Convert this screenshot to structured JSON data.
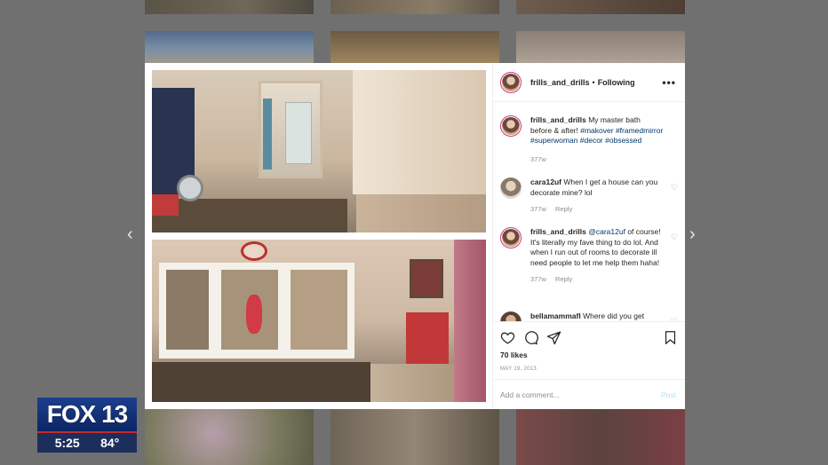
{
  "navigation": {
    "prev_icon": "chevron-left-icon",
    "next_icon": "chevron-right-icon",
    "prev_label": "‹",
    "next_label": "›"
  },
  "post": {
    "username": "frills_and_drills",
    "separator": "•",
    "follow_status": "Following",
    "more_label": "•••",
    "caption": {
      "username": "frills_and_drills",
      "text": "My master bath before & after!",
      "hashtags": [
        "#makover",
        "#framedmirror",
        "#superwoman",
        "#decor",
        "#obsessed"
      ],
      "time": "377w"
    },
    "comments": [
      {
        "username": "cara12uf",
        "text": "When I get a house can you decorate mine? lol",
        "time": "377w",
        "reply_label": "Reply"
      },
      {
        "username": "frills_and_drills",
        "mention": "@cara12uf",
        "text": "of course! It's literally my fave thing to do lol. And when I run out of rooms to decorate ill need people to let me help them haha!",
        "time": "377w",
        "reply_label": "Reply"
      },
      {
        "username": "bellamammafl",
        "text": "Where did you get"
      }
    ],
    "likes": "70 likes",
    "date": "MAY 19, 2013",
    "add_comment_placeholder": "Add a comment...",
    "post_label": "Post"
  },
  "tv_bug": {
    "logo": "FOX 13",
    "time": "5:25",
    "temp": "84°"
  },
  "colors": {
    "story_ring": "#d4327a",
    "hashtag": "#00376b",
    "post_disabled": "#b2dffc",
    "bug_blue": "#1b3f8f",
    "bug_red": "#c7282c"
  }
}
